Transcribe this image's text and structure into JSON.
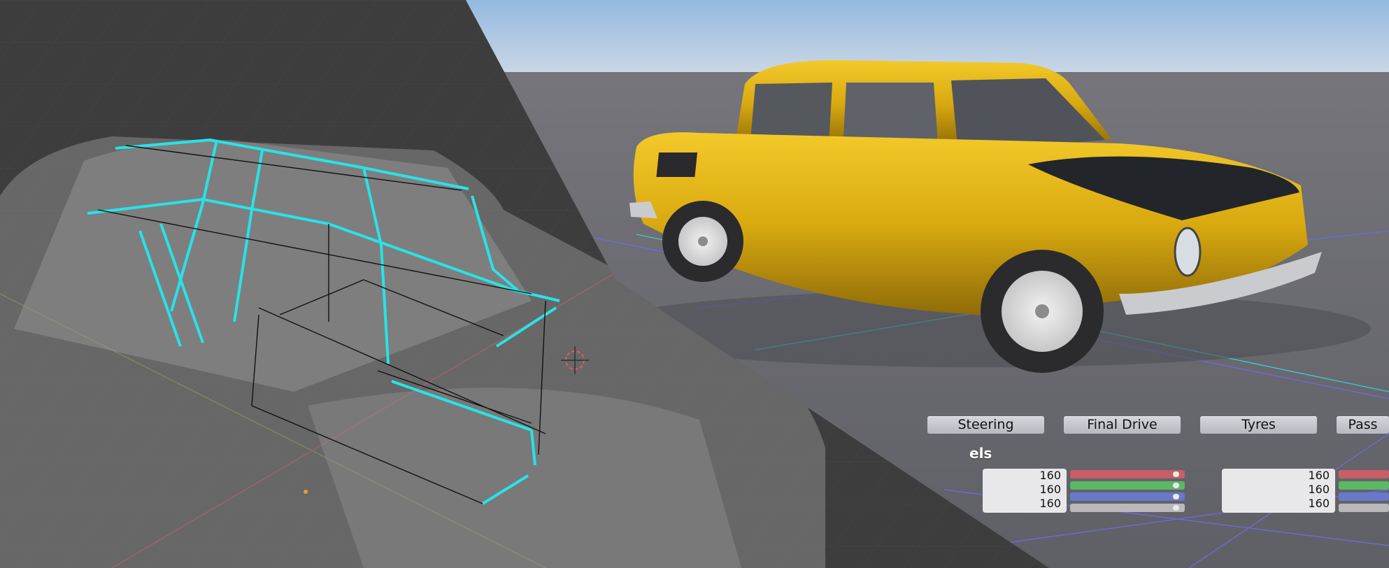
{
  "colors": {
    "sky_top": "#a9c7e6",
    "ground": "#6b6b71",
    "car_body": "#e3b514",
    "car_hood": "#22262b",
    "wire_highlight": "#27e3e8",
    "slider_red": "#c85f66",
    "slider_green": "#5bb864",
    "slider_blue": "#6779c8",
    "slider_gray": "#b9b9bc"
  },
  "left_viewport": {
    "icons": [
      "3d-cursor-icon",
      "origin-dot-icon"
    ]
  },
  "tabs": [
    {
      "label": "Steering"
    },
    {
      "label": "Final Drive"
    },
    {
      "label": "Tyres"
    },
    {
      "label": "Pass"
    }
  ],
  "wheels_panel": {
    "title": "els",
    "group1": {
      "values": [
        "160",
        "160",
        "160"
      ],
      "levels": [
        0.9,
        0.9,
        0.9
      ]
    },
    "group2": {
      "values": [
        "160",
        "160",
        "160"
      ]
    }
  }
}
